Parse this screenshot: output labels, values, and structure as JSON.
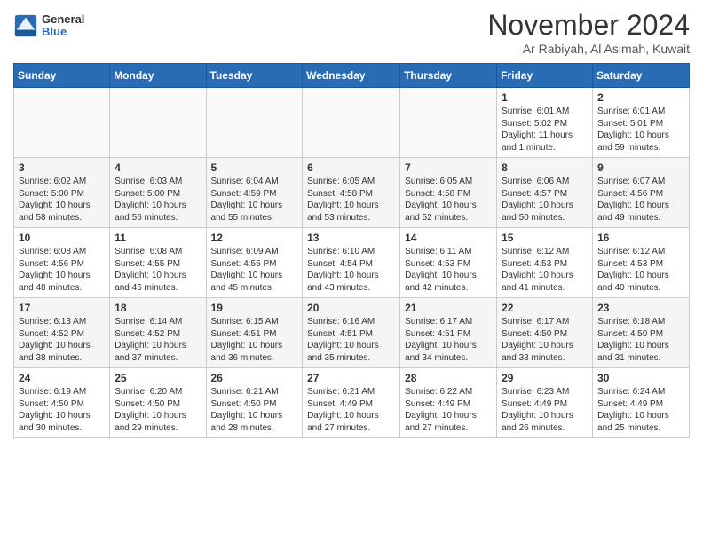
{
  "logo": {
    "general": "General",
    "blue": "Blue"
  },
  "header": {
    "month": "November 2024",
    "location": "Ar Rabiyah, Al Asimah, Kuwait"
  },
  "weekdays": [
    "Sunday",
    "Monday",
    "Tuesday",
    "Wednesday",
    "Thursday",
    "Friday",
    "Saturday"
  ],
  "weeks": [
    [
      {
        "day": "",
        "info": ""
      },
      {
        "day": "",
        "info": ""
      },
      {
        "day": "",
        "info": ""
      },
      {
        "day": "",
        "info": ""
      },
      {
        "day": "",
        "info": ""
      },
      {
        "day": "1",
        "info": "Sunrise: 6:01 AM\nSunset: 5:02 PM\nDaylight: 11 hours\nand 1 minute."
      },
      {
        "day": "2",
        "info": "Sunrise: 6:01 AM\nSunset: 5:01 PM\nDaylight: 10 hours\nand 59 minutes."
      }
    ],
    [
      {
        "day": "3",
        "info": "Sunrise: 6:02 AM\nSunset: 5:00 PM\nDaylight: 10 hours\nand 58 minutes."
      },
      {
        "day": "4",
        "info": "Sunrise: 6:03 AM\nSunset: 5:00 PM\nDaylight: 10 hours\nand 56 minutes."
      },
      {
        "day": "5",
        "info": "Sunrise: 6:04 AM\nSunset: 4:59 PM\nDaylight: 10 hours\nand 55 minutes."
      },
      {
        "day": "6",
        "info": "Sunrise: 6:05 AM\nSunset: 4:58 PM\nDaylight: 10 hours\nand 53 minutes."
      },
      {
        "day": "7",
        "info": "Sunrise: 6:05 AM\nSunset: 4:58 PM\nDaylight: 10 hours\nand 52 minutes."
      },
      {
        "day": "8",
        "info": "Sunrise: 6:06 AM\nSunset: 4:57 PM\nDaylight: 10 hours\nand 50 minutes."
      },
      {
        "day": "9",
        "info": "Sunrise: 6:07 AM\nSunset: 4:56 PM\nDaylight: 10 hours\nand 49 minutes."
      }
    ],
    [
      {
        "day": "10",
        "info": "Sunrise: 6:08 AM\nSunset: 4:56 PM\nDaylight: 10 hours\nand 48 minutes."
      },
      {
        "day": "11",
        "info": "Sunrise: 6:08 AM\nSunset: 4:55 PM\nDaylight: 10 hours\nand 46 minutes."
      },
      {
        "day": "12",
        "info": "Sunrise: 6:09 AM\nSunset: 4:55 PM\nDaylight: 10 hours\nand 45 minutes."
      },
      {
        "day": "13",
        "info": "Sunrise: 6:10 AM\nSunset: 4:54 PM\nDaylight: 10 hours\nand 43 minutes."
      },
      {
        "day": "14",
        "info": "Sunrise: 6:11 AM\nSunset: 4:53 PM\nDaylight: 10 hours\nand 42 minutes."
      },
      {
        "day": "15",
        "info": "Sunrise: 6:12 AM\nSunset: 4:53 PM\nDaylight: 10 hours\nand 41 minutes."
      },
      {
        "day": "16",
        "info": "Sunrise: 6:12 AM\nSunset: 4:53 PM\nDaylight: 10 hours\nand 40 minutes."
      }
    ],
    [
      {
        "day": "17",
        "info": "Sunrise: 6:13 AM\nSunset: 4:52 PM\nDaylight: 10 hours\nand 38 minutes."
      },
      {
        "day": "18",
        "info": "Sunrise: 6:14 AM\nSunset: 4:52 PM\nDaylight: 10 hours\nand 37 minutes."
      },
      {
        "day": "19",
        "info": "Sunrise: 6:15 AM\nSunset: 4:51 PM\nDaylight: 10 hours\nand 36 minutes."
      },
      {
        "day": "20",
        "info": "Sunrise: 6:16 AM\nSunset: 4:51 PM\nDaylight: 10 hours\nand 35 minutes."
      },
      {
        "day": "21",
        "info": "Sunrise: 6:17 AM\nSunset: 4:51 PM\nDaylight: 10 hours\nand 34 minutes."
      },
      {
        "day": "22",
        "info": "Sunrise: 6:17 AM\nSunset: 4:50 PM\nDaylight: 10 hours\nand 33 minutes."
      },
      {
        "day": "23",
        "info": "Sunrise: 6:18 AM\nSunset: 4:50 PM\nDaylight: 10 hours\nand 31 minutes."
      }
    ],
    [
      {
        "day": "24",
        "info": "Sunrise: 6:19 AM\nSunset: 4:50 PM\nDaylight: 10 hours\nand 30 minutes."
      },
      {
        "day": "25",
        "info": "Sunrise: 6:20 AM\nSunset: 4:50 PM\nDaylight: 10 hours\nand 29 minutes."
      },
      {
        "day": "26",
        "info": "Sunrise: 6:21 AM\nSunset: 4:50 PM\nDaylight: 10 hours\nand 28 minutes."
      },
      {
        "day": "27",
        "info": "Sunrise: 6:21 AM\nSunset: 4:49 PM\nDaylight: 10 hours\nand 27 minutes."
      },
      {
        "day": "28",
        "info": "Sunrise: 6:22 AM\nSunset: 4:49 PM\nDaylight: 10 hours\nand 27 minutes."
      },
      {
        "day": "29",
        "info": "Sunrise: 6:23 AM\nSunset: 4:49 PM\nDaylight: 10 hours\nand 26 minutes."
      },
      {
        "day": "30",
        "info": "Sunrise: 6:24 AM\nSunset: 4:49 PM\nDaylight: 10 hours\nand 25 minutes."
      }
    ]
  ]
}
